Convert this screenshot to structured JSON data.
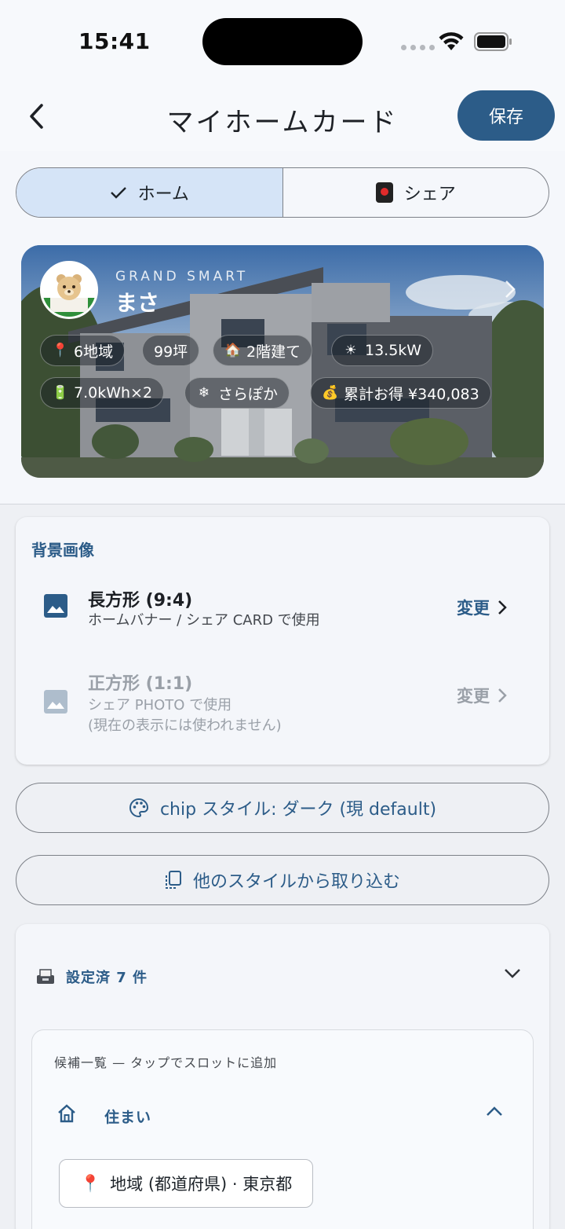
{
  "status_bar": {
    "time": "15:41"
  },
  "header": {
    "title": "マイホームカード",
    "save_label": "保存"
  },
  "tabs": [
    {
      "label": "ホーム",
      "icon": "check-icon",
      "selected": true
    },
    {
      "label": "シェア",
      "icon": "card-icon",
      "selected": false
    }
  ],
  "banner": {
    "brand": "GRAND SMART",
    "owner_name": "まさ",
    "chips_row1": [
      {
        "icon": "📍",
        "label": "6地域"
      },
      {
        "icon": "",
        "label": "99坪"
      },
      {
        "icon": "🏠",
        "label": "2階建て"
      },
      {
        "icon": "☀",
        "label": "13.5kW"
      }
    ],
    "chips_row2": [
      {
        "icon": "🔋",
        "label": "7.0kWh×2"
      },
      {
        "icon": "❄",
        "label": "さらぽか"
      },
      {
        "icon": "💰",
        "label": "累計お得 ¥340,083"
      }
    ]
  },
  "background_image": {
    "section_title": "背景画像",
    "items": [
      {
        "title": "長方形 (9:4)",
        "subtitle": "ホームバナー / シェア CARD で使用",
        "action": "変更",
        "enabled": true
      },
      {
        "title": "正方形 (1:1)",
        "subtitle": "シェア PHOTO で使用",
        "subtitle2": "(現在の表示には使われません)",
        "action": "変更",
        "enabled": false
      }
    ]
  },
  "chip_style_button": "chip スタイル: ダーク (現 default)",
  "import_button": "他のスタイルから取り込む",
  "slots": {
    "header": "設定済 7 件",
    "candidates_note": "候補一覧 — タップでスロットに追加",
    "category": "住まい",
    "candidate_chip": {
      "icon": "📍",
      "label": "地域 (都道府県) · 東京都"
    }
  },
  "colors": {
    "accent": "#2c5c88",
    "tab_selected_bg": "#d5e4f7",
    "disabled_text": "#9aa0a8"
  }
}
